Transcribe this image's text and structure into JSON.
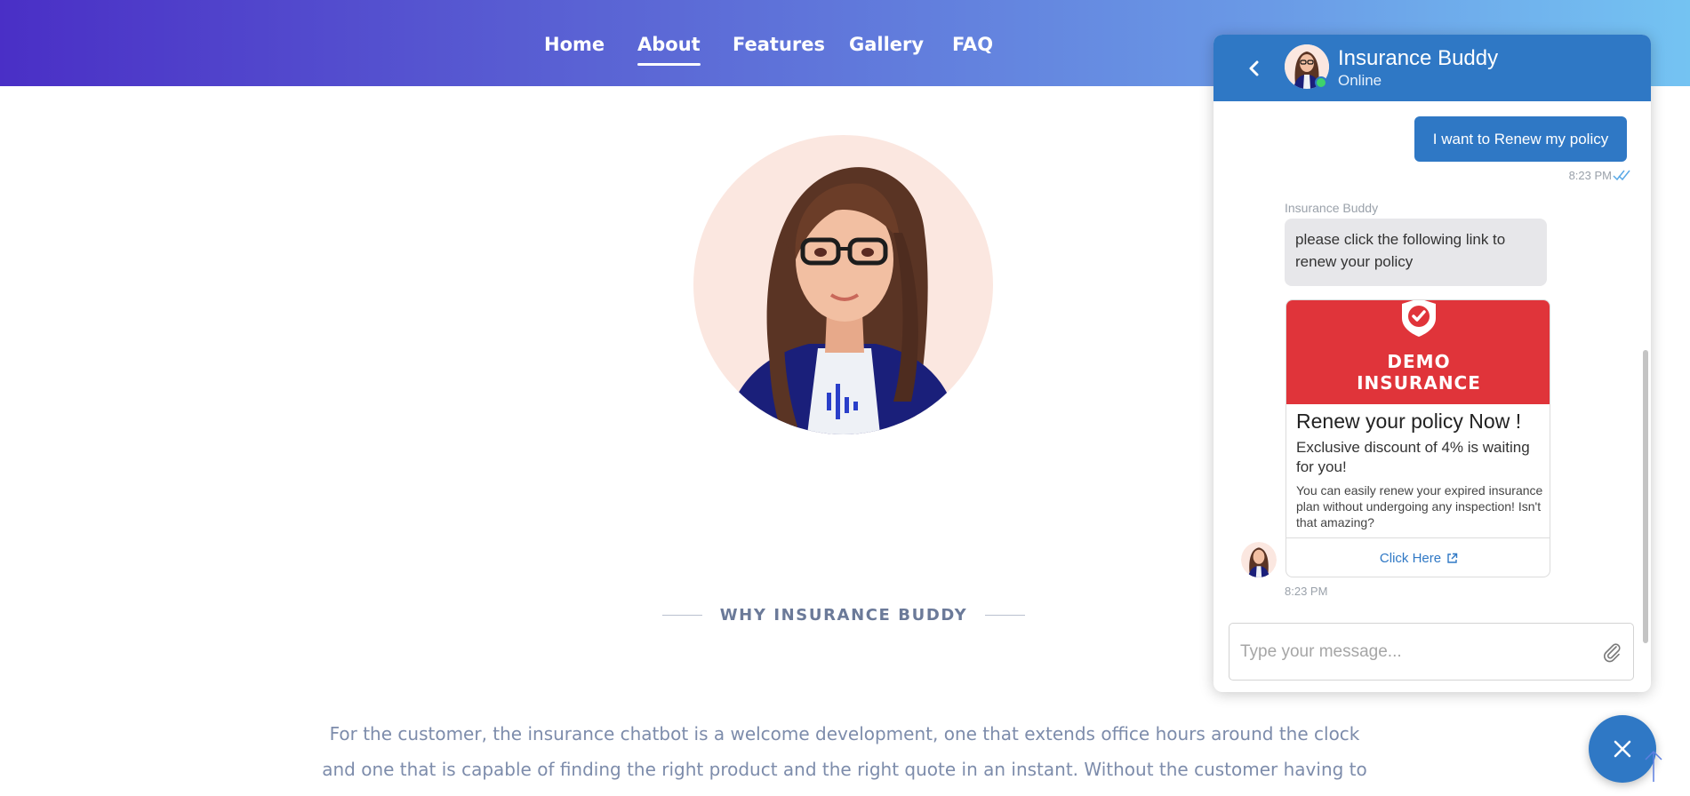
{
  "nav": {
    "items": [
      {
        "label": "Home",
        "active": false
      },
      {
        "label": "About",
        "active": true
      },
      {
        "label": "Features",
        "active": false
      },
      {
        "label": "Gallery",
        "active": false
      },
      {
        "label": "FAQ",
        "active": false
      }
    ]
  },
  "hero": {
    "avatar_icon": "assistant-avatar-illustration"
  },
  "why_section": {
    "title": "WHY INSURANCE BUDDY",
    "paragraph": "For the customer, the insurance chatbot is a welcome development, one that extends office hours around the clock and one that is capable of finding the right product and the right quote in an instant. Without the customer having to pick up the"
  },
  "chat": {
    "header": {
      "name": "Insurance Buddy",
      "status": "Online",
      "back_icon": "chevron-left-icon",
      "status_color": "#3ed36b"
    },
    "user_message": {
      "text": "I want to Renew my policy",
      "time": "8:23 PM",
      "read_icon": "double-check-icon"
    },
    "bot_sender_label": "Insurance Buddy",
    "bot_message": {
      "text": "please click the following link to renew your policy"
    },
    "card": {
      "brand_line1": "DEMO",
      "brand_line2": "INSURANCE",
      "title": "Renew your policy Now !",
      "subtitle": "Exclusive discount of 4% is waiting for you!",
      "description": "You can easily renew your expired insurance plan without undergoing any inspection! Isn't that amazing?",
      "link_label": "Click Here",
      "link_icon": "external-link-icon",
      "banner_color": "#e0343a"
    },
    "bot_time": "8:23 PM",
    "input": {
      "placeholder": "Type your message...",
      "value": ""
    },
    "attach_icon": "paperclip-icon"
  },
  "fab": {
    "icon": "close-icon"
  },
  "scroll_top": {
    "icon": "arrow-up-icon"
  },
  "colors": {
    "primary": "#2f78c5",
    "header_gradient_start": "#4a2fc6",
    "header_gradient_end": "#74c3f2"
  }
}
